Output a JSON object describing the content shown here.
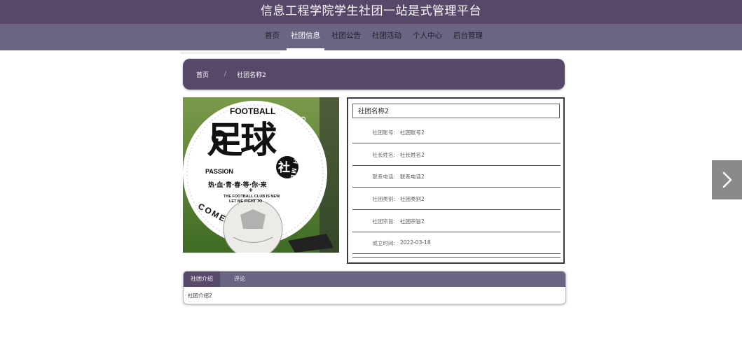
{
  "header": {
    "title": "信息工程学院学生社团一站是式管理平台"
  },
  "nav": {
    "items": [
      {
        "label": "首页"
      },
      {
        "label": "社团信息"
      },
      {
        "label": "社团公告"
      },
      {
        "label": "社团活动"
      },
      {
        "label": "个人中心"
      },
      {
        "label": "后台管理"
      }
    ],
    "active_index": 1
  },
  "breadcrumb": {
    "home": "首页",
    "separator": "/",
    "current": "社团名称2"
  },
  "poster": {
    "headline": "FOOTBALL",
    "big_chars": "足球",
    "small_char": "社",
    "passion": "PASSION",
    "slogan_cn": "热·血·青·春·等·你·来",
    "plus": "+",
    "slogan_en_1": "THE FOOTBALL CLUB IS NEW",
    "slogan_en_2": "LET ME FIGHT TO",
    "ring_text_1": "COME",
    "ring_text_2": "COME WITH ME"
  },
  "club": {
    "name": "社团名称2",
    "fields": [
      {
        "label": "社团账号:",
        "value": "社团账号2"
      },
      {
        "label": "社长姓名:",
        "value": "社长姓名2"
      },
      {
        "label": "联系电话:",
        "value": "联系电话2"
      },
      {
        "label": "社团类别:",
        "value": "社团类别2"
      },
      {
        "label": "社团宗旨:",
        "value": "社团宗旨2"
      },
      {
        "label": "成立时间:",
        "value": "2022-03-18"
      }
    ]
  },
  "tabs": {
    "items": [
      {
        "label": "社团介绍"
      },
      {
        "label": "评论"
      }
    ],
    "content": "社团介绍2"
  },
  "colors": {
    "primary": "#574869",
    "nav": "#6c6483",
    "arrow": "#8a8a8a"
  },
  "icons": {
    "next": "chevron-right-icon"
  }
}
